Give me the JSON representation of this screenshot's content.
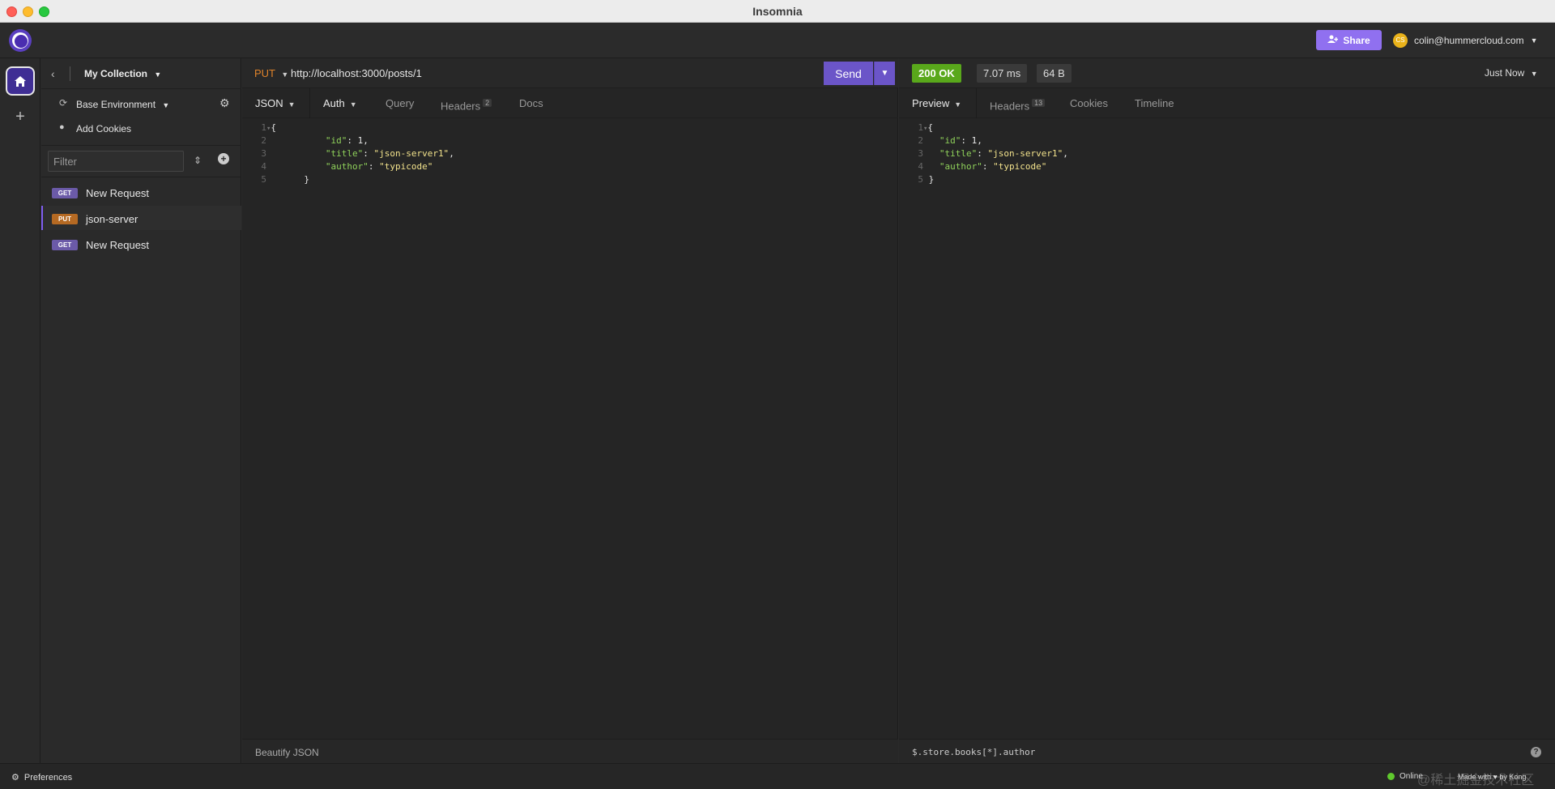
{
  "window": {
    "title": "Insomnia"
  },
  "appbar": {
    "share_label": "Share",
    "user_email": "colin@hummercloud.com",
    "avatar_initials": "CS"
  },
  "sidebar": {
    "collection_name": "My Collection",
    "environment": "Base Environment",
    "add_cookies": "Add Cookies",
    "filter_placeholder": "Filter",
    "requests": [
      {
        "method": "GET",
        "name": "New Request",
        "active": false
      },
      {
        "method": "PUT",
        "name": "json-server",
        "active": true
      },
      {
        "method": "GET",
        "name": "New Request",
        "active": false
      }
    ]
  },
  "request": {
    "method": "PUT",
    "url": "http://localhost:3000/posts/1",
    "send_label": "Send",
    "tabs": {
      "body": "JSON",
      "auth": "Auth",
      "query": "Query",
      "headers": "Headers",
      "headers_count": "2",
      "docs": "Docs"
    },
    "body_lines": [
      {
        "n": "1",
        "text": "{"
      },
      {
        "n": "2",
        "key": "\"id\"",
        "value": "1",
        "value_type": "num",
        "comma": ","
      },
      {
        "n": "3",
        "key": "\"title\"",
        "value": "\"json-server1\"",
        "value_type": "str",
        "comma": ","
      },
      {
        "n": "4",
        "key": "\"author\"",
        "value": "\"typicode\"",
        "value_type": "str",
        "comma": ""
      },
      {
        "n": "5",
        "text": "}"
      }
    ],
    "footer_action": "Beautify JSON"
  },
  "response": {
    "status": "200 OK",
    "time": "7.07 ms",
    "size": "64 B",
    "timestamp": "Just Now",
    "tabs": {
      "preview": "Preview",
      "headers": "Headers",
      "headers_count": "13",
      "cookies": "Cookies",
      "timeline": "Timeline"
    },
    "jsonpath_placeholder": "$.store.books[*].author"
  },
  "statusbar": {
    "preferences": "Preferences",
    "online": "Online",
    "made_with": "Made with ♥ by Kong",
    "watermark": "@稀土掘金技术社区"
  },
  "colors": {
    "accent": "#6b55c8",
    "share": "#9070f0",
    "status_ok": "#59a81b",
    "method_put": "#e0832a",
    "json_key": "#8fd15a",
    "json_string": "#f2e28c"
  }
}
